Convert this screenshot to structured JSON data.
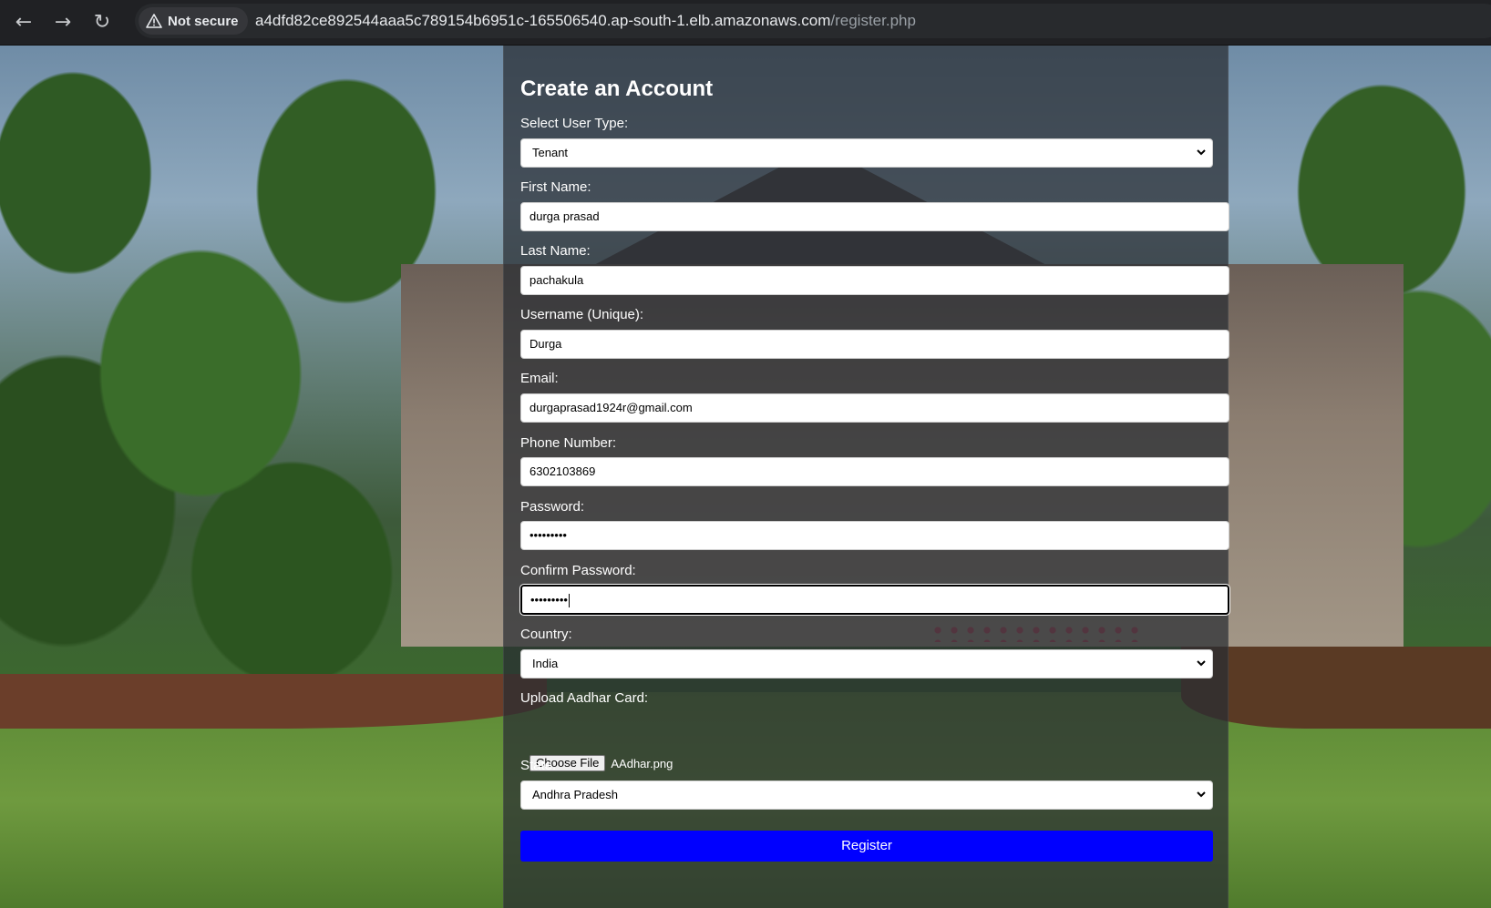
{
  "browser": {
    "back_icon": "arrow-left-icon",
    "forward_icon": "arrow-right-icon",
    "reload_icon": "reload-icon",
    "security_label": "Not secure",
    "url_host": "a4dfd82ce892544aaa5c789154b6951c-165506540.ap-south-1.elb.amazonaws.com",
    "url_path": "/register.php"
  },
  "form": {
    "title": "Create an Account",
    "user_type": {
      "label": "Select User Type:",
      "value": "Tenant"
    },
    "first_name": {
      "label": "First Name:",
      "value": "durga prasad"
    },
    "last_name": {
      "label": "Last Name:",
      "value": "pachakula"
    },
    "username": {
      "label": "Username (Unique):",
      "value": "Durga"
    },
    "email": {
      "label": "Email:",
      "value": "durgaprasad1924r@gmail.com"
    },
    "phone": {
      "label": "Phone Number:",
      "value": "6302103869"
    },
    "password": {
      "label": "Password:",
      "value": "•••••••••"
    },
    "confirm_password": {
      "label": "Confirm Password:",
      "value": "•••••••••"
    },
    "country": {
      "label": "Country:",
      "value": "India"
    },
    "aadhar": {
      "label": "Upload Aadhar Card:",
      "button_label": "Choose File",
      "file_name": "AAdhar.png"
    },
    "state": {
      "label": "State:",
      "value": "Andhra Pradesh"
    },
    "register_label": "Register"
  },
  "colors": {
    "register_button": "#0000ff",
    "panel_overlay": "rgba(40,44,50,0.72)"
  }
}
